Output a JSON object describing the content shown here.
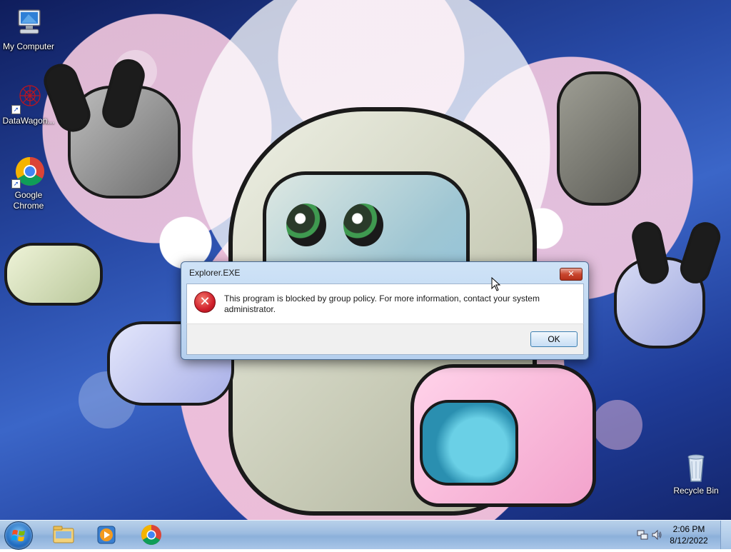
{
  "desktop": {
    "icons": [
      {
        "label": "My Computer",
        "icon": "computer-icon"
      },
      {
        "label": "DataWagon...",
        "icon": "datawagon-icon"
      },
      {
        "label": "Google Chrome",
        "icon": "chrome-icon"
      },
      {
        "label": "Recycle Bin",
        "icon": "recycle-bin-icon"
      }
    ]
  },
  "dialog": {
    "title": "Explorer.EXE",
    "close_label": "✕",
    "message": "This program is blocked by group policy. For more information, contact your system administrator.",
    "ok_label": "OK",
    "icon": "error-icon"
  },
  "taskbar": {
    "start": "start-orb",
    "pinned": [
      "explorer-icon",
      "media-player-icon",
      "chrome-icon"
    ],
    "tray_icons": [
      "network-icon",
      "volume-icon"
    ],
    "time": "2:06 PM",
    "date": "8/12/2022"
  }
}
